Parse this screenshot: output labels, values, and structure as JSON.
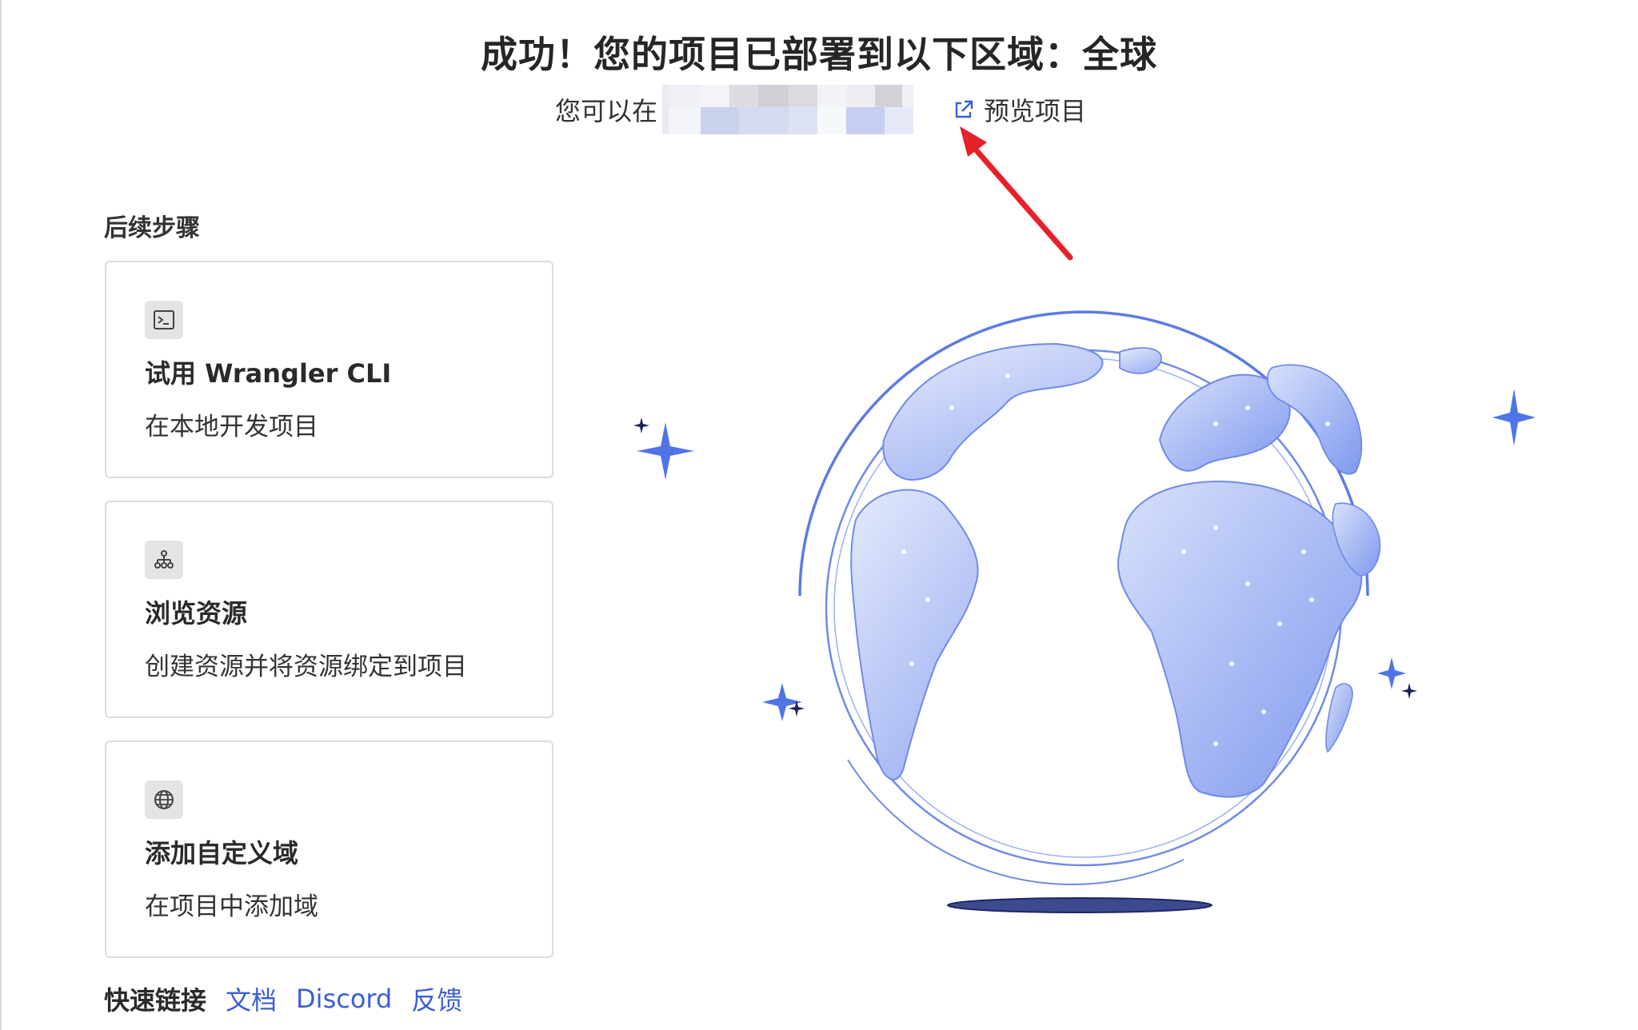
{
  "header": {
    "title": "成功！您的项目已部署到以下区域：全球",
    "preview_prefix": "您可以在",
    "preview_link_label": "预览项目"
  },
  "next_steps": {
    "title": "后续步骤",
    "cards": [
      {
        "icon": "terminal-icon",
        "title": "试用 Wrangler CLI",
        "description": "在本地开发项目"
      },
      {
        "icon": "sitemap-icon",
        "title": "浏览资源",
        "description": "创建资源并将资源绑定到项目"
      },
      {
        "icon": "globe-icon",
        "title": "添加自定义域",
        "description": "在项目中添加域"
      }
    ]
  },
  "quick_links": {
    "label": "快速链接",
    "links": [
      "文档",
      "Discord",
      "反馈"
    ]
  },
  "colors": {
    "accent": "#3b5ed6",
    "annotation_arrow": "#e8202a",
    "globe_fill": "#8fa6f2",
    "sparkle": "#4f74e8"
  }
}
